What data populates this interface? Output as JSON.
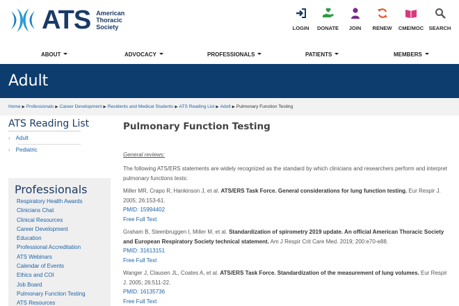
{
  "header": {
    "logo_mark": "ATS",
    "logo_lines": [
      "American",
      "Thoracic",
      "Society"
    ],
    "utility": [
      {
        "label": "LOGIN",
        "icon": "login-icon",
        "color": "#1a3a66"
      },
      {
        "label": "DONATE",
        "icon": "donate-hand-icon",
        "color": "#2e9c45"
      },
      {
        "label": "JOIN",
        "icon": "person-icon",
        "color": "#7a2a8c"
      },
      {
        "label": "RENEW",
        "icon": "renew-arrows-icon",
        "color": "#e05a2b"
      },
      {
        "label": "CME/MOC",
        "icon": "book-icon",
        "color": "#d63a7d"
      },
      {
        "label": "SEARCH",
        "icon": "search-icon",
        "color": "#555555"
      }
    ]
  },
  "nav": {
    "items": [
      "ABOUT",
      "ADVOCACY",
      "PROFESSIONALS",
      "PATIENTS",
      "MEMBERS"
    ]
  },
  "banner": {
    "title": "Adult"
  },
  "breadcrumb": {
    "links": [
      "Home",
      "Professionals",
      "Career Development",
      "Residents and Medical Students",
      "ATS Reading List",
      "Adult"
    ],
    "current": "Pulmonary Function Testing"
  },
  "sidebar": {
    "title": "ATS Reading List",
    "items": [
      "Adult",
      "Pediatric"
    ],
    "professionals_title": "Professionals",
    "professionals": [
      "Respiratory Health Awards",
      "Clinicians Chat",
      "Clinical Resources",
      "Career Development",
      "Education",
      "Professional Accreditation",
      "ATS Webinars",
      "Calendar of Events",
      "Ethics and COI",
      "Job Board",
      "Pulmonary Function Testing",
      "ATS Resources"
    ]
  },
  "main": {
    "title": "Pulmonary Function Testing",
    "general_reviews": "General reviews:",
    "intro": "The following ATS/ERS statements are widely recognized as the standard by which clinicians and researchers perform and interpret pulmonary functions tests:",
    "refs": [
      {
        "authors": "Miller MR, Crapo R, Hankinson J, et al.",
        "title": "ATS/ERS Task Force. General considerations for lung function testing.",
        "source": "Eur Respir J. 2005; 26:153-61.",
        "pmid": "PMID: 15994402",
        "link": "Free Full Text"
      },
      {
        "authors": "Graham B, Steenbruggen I, Miller M, et al.",
        "title": "Standardization of spirometry 2019 update. An official American Thoracic Society and European Respiratory Society technical statement.",
        "source": "Am J Respir Crit Care Med. 2019; 200:e70-e88.",
        "pmid": "PMID: 31613151",
        "link": "Free Full Text"
      },
      {
        "authors": "Wanger J, Clausen JL, Coates A, et al.",
        "title": "ATS/ERS Task Force. Standardization of the measurement of lung volumes.",
        "source": "Eur Respir J. 2005; 26:511-22.",
        "pmid": "PMID: 16135736",
        "link": "Free Full Text"
      }
    ]
  }
}
